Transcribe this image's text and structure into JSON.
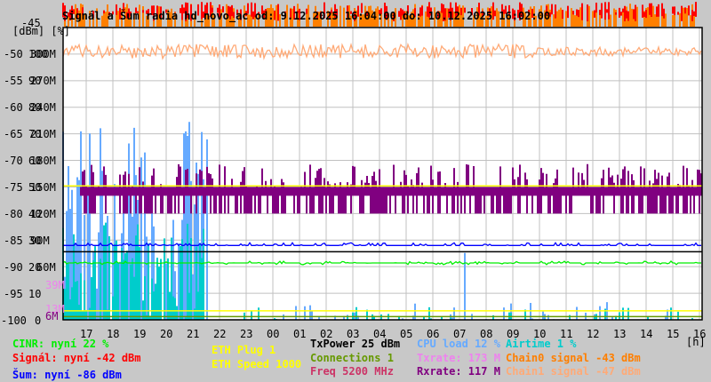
{
  "title": "Signál a Šum radia hd_novo_ac od: 9.12.2025 16:04:00 do: 10.12.2025 16:02:00",
  "chart_data": {
    "type": "line",
    "title": "Signál a Šum radia hd_novo_ac od: 9.12.2025 16:04:00 do: 10.12.2025 16:02:00",
    "ylabel": "[dBm] [%]",
    "xlabel": "[h]",
    "ylim": [
      -100,
      -45
    ],
    "y_ticks_dbm": [
      "-45",
      "-50",
      "-55",
      "-60",
      "-65",
      "-70",
      "-75",
      "-80",
      "-85",
      "-90",
      "-95",
      "-100"
    ],
    "y_ticks_pct": [
      "100",
      "90",
      "80",
      "70",
      "60",
      "50",
      "40",
      "30",
      "20",
      "10",
      "0"
    ],
    "y_ticks_rate": [
      "300M",
      "270M",
      "240M",
      "210M",
      "180M",
      "150M",
      "120M",
      "90M",
      "60M",
      "30M"
    ],
    "y_ticks_extra": [
      "39M",
      "13M",
      "6M"
    ],
    "x_ticks": [
      "17",
      "18",
      "19",
      "20",
      "21",
      "22",
      "23",
      "00",
      "01",
      "02",
      "03",
      "04",
      "05",
      "06",
      "07",
      "08",
      "09",
      "10",
      "11",
      "12",
      "13",
      "14",
      "15",
      "16"
    ],
    "grid": true,
    "series": [
      {
        "name": "Signál",
        "color": "#ff0000",
        "current": -42
      },
      {
        "name": "Chain0 signal",
        "color": "#ff7f00",
        "current": -43
      },
      {
        "name": "Chain1 signal",
        "color": "#ffaa77",
        "current": -47
      },
      {
        "name": "Rxrate",
        "color": "#800080",
        "current": 117
      },
      {
        "name": "Šum",
        "color": "#0000ff",
        "current": -86
      },
      {
        "name": "TxPower",
        "color": "#000000",
        "current": 25
      },
      {
        "name": "CINR",
        "color": "#00ee00",
        "current": 22
      },
      {
        "name": "ETH Speed",
        "color": "#ffff00",
        "current": 1000
      },
      {
        "name": "CPU load",
        "color": "#66aaff",
        "current": 12
      },
      {
        "name": "Airtime",
        "color": "#00cccc",
        "current": 1
      },
      {
        "name": "Connections",
        "color": "#669900",
        "current": 1
      }
    ]
  },
  "legend": {
    "cinr": "CINR: nyní 22 %",
    "signal": "Signál: nyní -42 dBm",
    "noise": "Šum: nyní -86 dBm",
    "eth_plug": "ETH Plug 1",
    "eth_speed": "ETH Speed 1000",
    "txpower": "TxPower 25 dBm",
    "connections": "Connections 1",
    "freq": "Freq 5200 MHz",
    "cpu": "CPU load 12 %",
    "txrate": "Txrate: 173 M",
    "rxrate": "Rxrate: 117 M",
    "airtime": "Airtime 1 %",
    "chain0": "Chain0 signal -43 dBm",
    "chain1": "Chain1 signal -47 dBm",
    "hours_unit": "[h]"
  },
  "colors": {
    "red": "#ff0000",
    "orange": "#ff7f00",
    "peach": "#ffaa77",
    "purple": "#800080",
    "blue": "#0000ff",
    "green": "#00ee00",
    "yellow": "#ffff00",
    "lightblue": "#66aaff",
    "cyan": "#00cccc",
    "olive": "#669900",
    "pink": "#ee82ee",
    "rose": "#cc3366"
  }
}
